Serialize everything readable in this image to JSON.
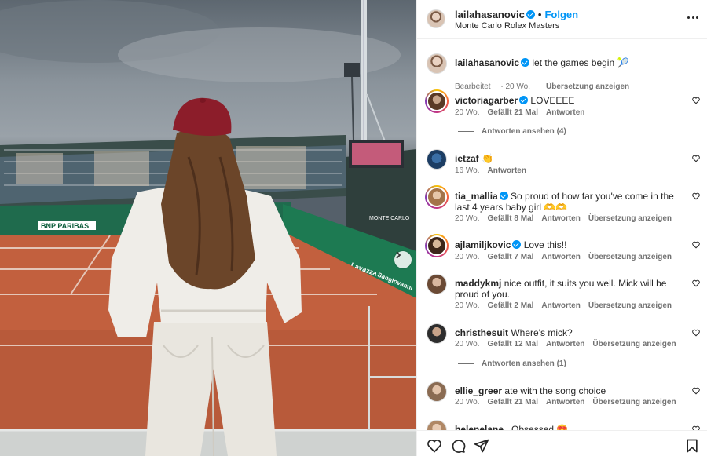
{
  "post": {
    "username": "lailahasanovic",
    "follow_label": "Folgen",
    "location": "Monte Carlo Rolex Masters",
    "caption": "let the games begin 🎾",
    "caption_edited": "Bearbeitet",
    "caption_age": "20 Wo.",
    "caption_translate": "Übersetzung anzeigen",
    "icons": {
      "more": "more-options-icon",
      "verified": "verified-badge-icon",
      "next": "chevron-right-icon"
    }
  },
  "photo": {
    "signs": [
      "BNP PARIBAS",
      "Lavazza",
      "Sangiovanni",
      "MONTE CARLO"
    ]
  },
  "comments": [
    {
      "user": "victoriagarber",
      "verified": true,
      "text": "LOVEEEE",
      "age": "20 Wo.",
      "likes": "Gefällt 21 Mal",
      "reply": "Antworten",
      "translate": "",
      "view_replies": "Antworten ansehen (4)"
    },
    {
      "user": "ietzaf",
      "verified": false,
      "text": "👏",
      "age": "16 Wo.",
      "likes": "",
      "reply": "Antworten",
      "translate": "",
      "view_replies": ""
    },
    {
      "user": "tia_mallia",
      "verified": true,
      "text": "So proud of how far you've come in the last 4 years baby girl 🫶🫶",
      "age": "20 Wo.",
      "likes": "Gefällt 8 Mal",
      "reply": "Antworten",
      "translate": "Übersetzung anzeigen",
      "view_replies": ""
    },
    {
      "user": "ajlamiljkovic",
      "verified": true,
      "text": "Love this!!",
      "age": "20 Wo.",
      "likes": "Gefällt 7 Mal",
      "reply": "Antworten",
      "translate": "Übersetzung anzeigen",
      "view_replies": ""
    },
    {
      "user": "maddykmj",
      "verified": false,
      "text": "nice outfit, it suits you well. Mick will be proud of you.",
      "age": "20 Wo.",
      "likes": "Gefällt 2 Mal",
      "reply": "Antworten",
      "translate": "Übersetzung anzeigen",
      "view_replies": ""
    },
    {
      "user": "christhesuit",
      "verified": false,
      "text": "Where's mick?",
      "age": "20 Wo.",
      "likes": "Gefällt 12 Mal",
      "reply": "Antworten",
      "translate": "Übersetzung anzeigen",
      "view_replies": "Antworten ansehen (1)"
    },
    {
      "user": "ellie_greer",
      "verified": false,
      "text": "ate with the song choice",
      "age": "20 Wo.",
      "likes": "Gefällt 21 Mal",
      "reply": "Antworten",
      "translate": "Übersetzung anzeigen",
      "view_replies": ""
    },
    {
      "user": "helenelane_",
      "verified": false,
      "text": "Obsessed 😍",
      "age": "",
      "likes": "",
      "reply": "",
      "translate": "",
      "view_replies": ""
    }
  ],
  "actions": [
    "like-icon",
    "comment-icon",
    "share-icon",
    "save-icon"
  ]
}
